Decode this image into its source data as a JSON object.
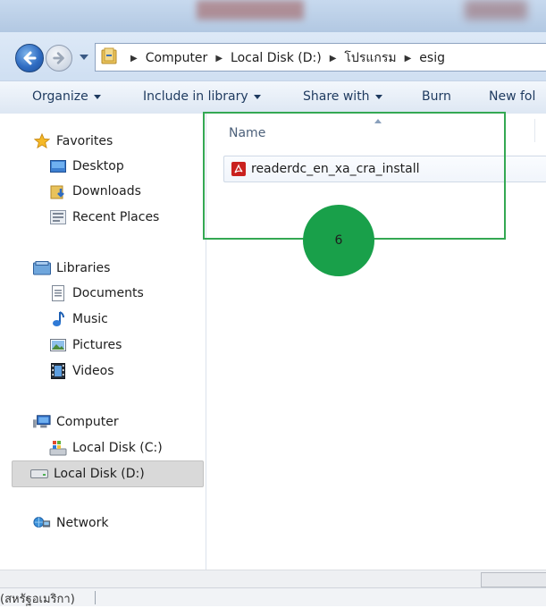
{
  "address": {
    "crumbs": [
      "Computer",
      "Local Disk (D:)",
      "โปรแกรม",
      "esig"
    ]
  },
  "toolbar": {
    "organize": "Organize",
    "include_in_library": "Include in library",
    "share_with": "Share with",
    "burn": "Burn",
    "new_folder": "New fol"
  },
  "navpane": {
    "favorites": "Favorites",
    "desktop": "Desktop",
    "downloads": "Downloads",
    "recent_places": "Recent Places",
    "libraries": "Libraries",
    "documents": "Documents",
    "music": "Music",
    "pictures": "Pictures",
    "videos": "Videos",
    "computer": "Computer",
    "local_disk_c": "Local Disk (C:)",
    "local_disk_d": "Local Disk (D:)",
    "network": "Network"
  },
  "content": {
    "column_name": "Name",
    "files": [
      {
        "name": "readerdc_en_xa_cra_install",
        "icon": "pdf-icon"
      }
    ]
  },
  "annotation": {
    "step_number": "6",
    "highlight_color": "#34a853",
    "circle_color": "#19a04a"
  },
  "status": {
    "text": "(สหรัฐอเมริกา)"
  }
}
